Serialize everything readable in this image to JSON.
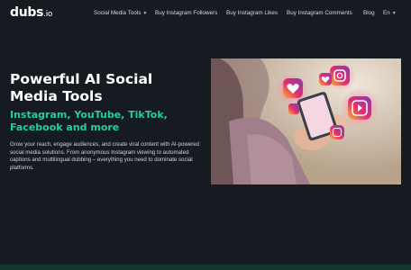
{
  "header": {
    "logo_main": "dubs",
    "logo_tld": ".io",
    "nav": [
      {
        "label": "Social Media Tools",
        "has_dropdown": true
      },
      {
        "label": "Buy Instagram Followers"
      },
      {
        "label": "Buy Instagram Likes"
      },
      {
        "label": "Buy Instagram Comments"
      },
      {
        "label": "Blog"
      },
      {
        "label": "En",
        "has_dropdown": true
      }
    ],
    "dropdown_icon": "chevron-down-icon"
  },
  "hero": {
    "title": "Powerful AI Social Media Tools",
    "subtitle": "Instagram, YouTube, TikTok, Facebook and more",
    "description": "Grow your reach, engage audiences, and create viral content with AI-powered social media solutions. From anonymous Instagram viewing to automated captions and multilingual dubbing – everything you need to dominate social platforms.",
    "image_icons": [
      "heart-icon",
      "instagram-icon",
      "reels-icon"
    ]
  },
  "colors": {
    "background": "#161b22",
    "accent": "#1fd19a",
    "text": "#ffffff"
  }
}
